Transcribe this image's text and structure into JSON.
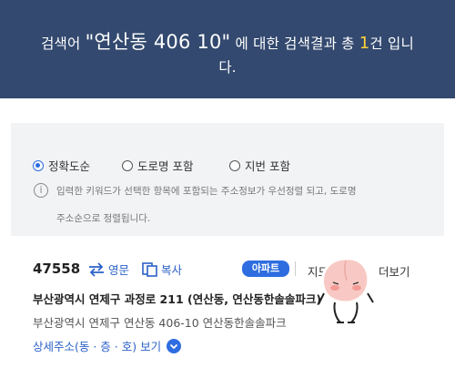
{
  "header": {
    "prefix": "검색어 ",
    "query": "\"연산동 406 10\"",
    "middle": " 에 대한 검색결과 총 ",
    "count": "1",
    "suffix": "건 입니",
    "line2": "다."
  },
  "filter": {
    "options": [
      {
        "label": "정확도순",
        "selected": true
      },
      {
        "label": "도로명 포함",
        "selected": false
      },
      {
        "label": "지번 포함",
        "selected": false
      }
    ],
    "notice_line1": "입력한 키워드가 선택한 항목에 포함되는 주소정보가 우선정렬 되고, 도로명",
    "notice_line2": "주소순으로 정렬됩니다."
  },
  "result": {
    "zipcode": "47558",
    "english_label": "영문",
    "copy_label": "복사",
    "badge": "아파트",
    "map_label": "지도보기",
    "more_label": "더보기",
    "road_address": "부산광역시 연제구 과정로 211 (연산동, 연산동한솔솔파크)",
    "jibun_address": "부산광역시 연제구 연산동 406-10 연산동한솔솔파크",
    "detail_label": "상세주소(동 · 층 · 호) 보기"
  },
  "colors": {
    "header_bg": "#33496f",
    "accent": "#2d6de0",
    "count": "#ffd339"
  }
}
